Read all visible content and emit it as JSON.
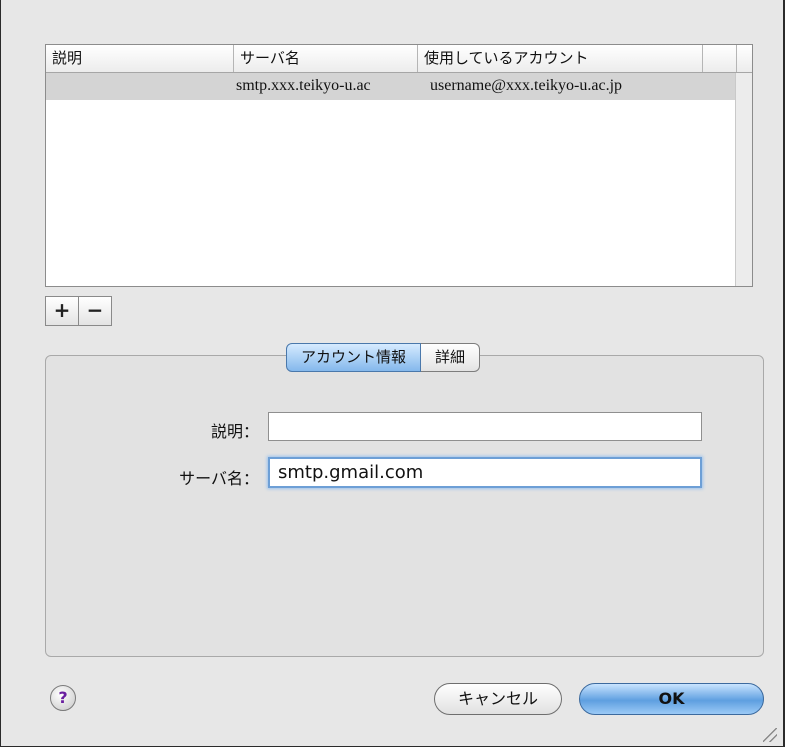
{
  "table": {
    "columns": [
      "説明",
      "サーバ名",
      "使用しているアカウント"
    ],
    "rows": [
      {
        "description": "",
        "server": "smtp.xxx.teikyo-u.ac",
        "account": "username@xxx.teikyo-u.ac.jp"
      }
    ]
  },
  "list_buttons": {
    "add": "+",
    "remove": "−"
  },
  "tabs": {
    "account_info": "アカウント情報",
    "advanced": "詳細"
  },
  "form": {
    "description_label": "説明：",
    "description_value": "",
    "server_label": "サーバ名：",
    "server_value": "smtp.gmail.com"
  },
  "footer": {
    "help": "?",
    "cancel": "キャンセル",
    "ok": "OK"
  }
}
